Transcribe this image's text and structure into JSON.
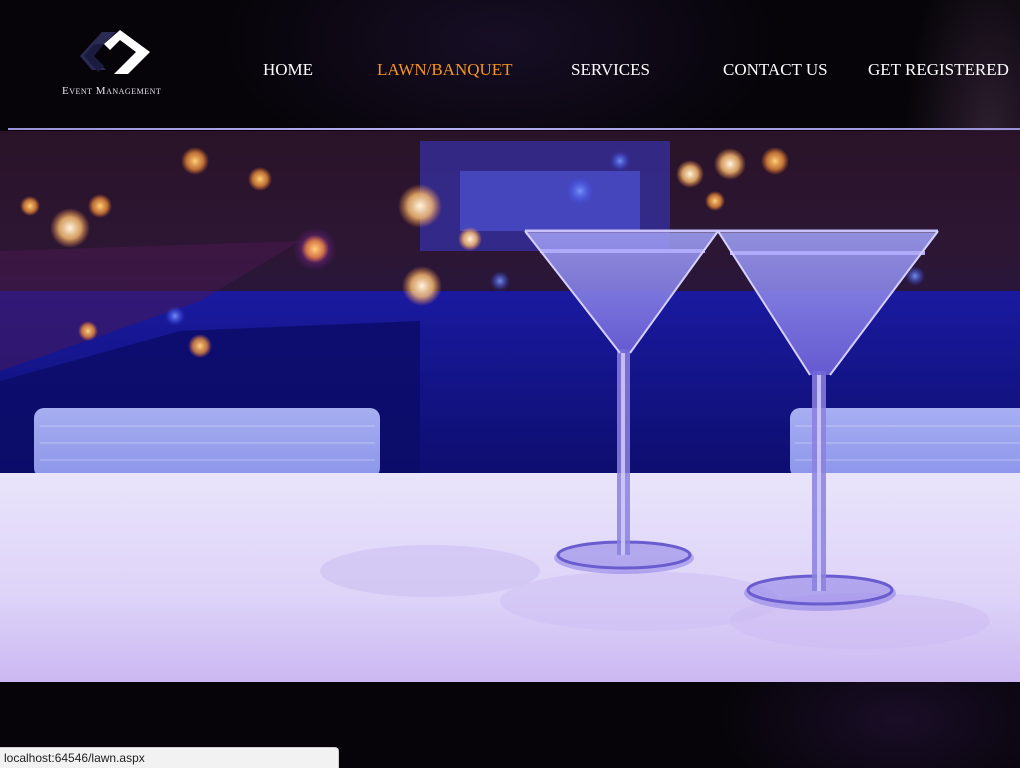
{
  "brand": {
    "logo_text": "Event Management"
  },
  "nav": {
    "items": [
      {
        "label": "HOME",
        "active": false
      },
      {
        "label": "LAWN/BANQUET",
        "active": true
      },
      {
        "label": "SERVICES",
        "active": false
      },
      {
        "label": "CONTACT US",
        "active": false
      },
      {
        "label": "GET REGISTERED",
        "active": false
      }
    ]
  },
  "colors": {
    "active_nav": "#f7941d",
    "nav_text": "#ffffff",
    "divider": "#b8b0f0",
    "background": "#060409"
  },
  "hero": {
    "image": "martini-glasses-poolside-night-photo"
  },
  "status_bar": {
    "url": "localhost:64546/lawn.aspx"
  }
}
